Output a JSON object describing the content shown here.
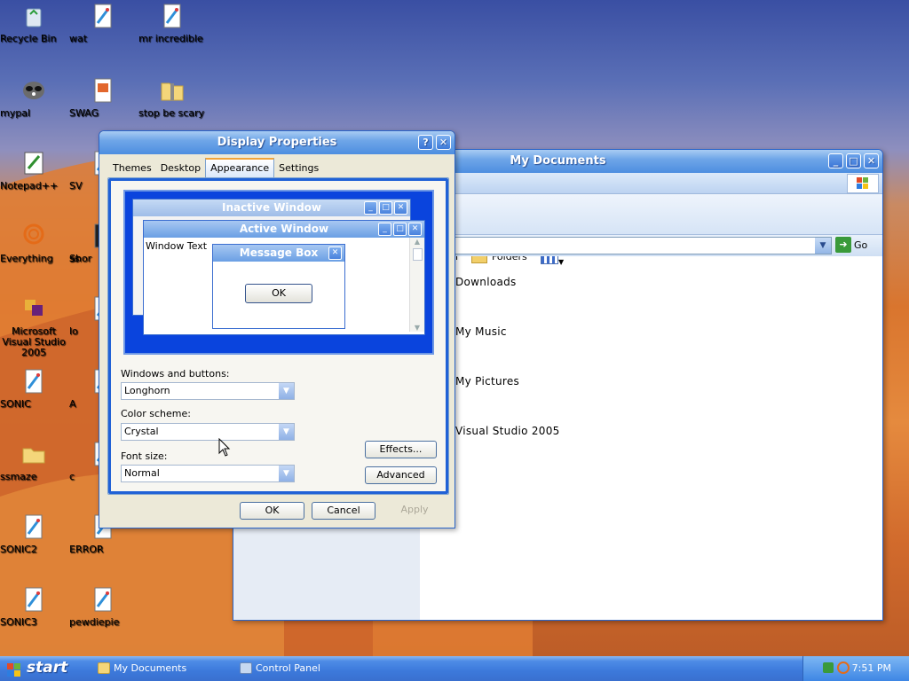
{
  "desktop": {
    "icons": [
      {
        "label": "Recycle Bin",
        "icon": "recycle-bin-icon"
      },
      {
        "label": "wat",
        "icon": "paint-file-icon"
      },
      {
        "label": "mr incredible",
        "icon": "paint-file-icon"
      },
      {
        "label": "mypal",
        "icon": "raccoon-shortcut-icon"
      },
      {
        "label": "SWAG",
        "icon": "image-file-icon"
      },
      {
        "label": "stop be scary",
        "icon": "zip-folder-icon"
      },
      {
        "label": "Notepad++",
        "icon": "notepadplusplus-icon"
      },
      {
        "label": "Everything",
        "icon": "everything-search-icon"
      },
      {
        "label": "Microsoft Visual Studio 2005",
        "icon": "visual-studio-icon"
      },
      {
        "label": "SONIC",
        "icon": "paint-file-icon"
      },
      {
        "label": "ssmaze",
        "icon": "folder-icon"
      },
      {
        "label": "SONIC2",
        "icon": "paint-file-icon"
      },
      {
        "label": "ERROR",
        "icon": "paint-file-icon"
      },
      {
        "label": "SONIC3",
        "icon": "paint-file-icon"
      },
      {
        "label": "pewdiepie",
        "icon": "paint-file-icon"
      }
    ],
    "partial_labels": [
      "SV",
      "Shor",
      "ss",
      "lo",
      "A",
      "c"
    ]
  },
  "mydocs": {
    "title": "My Documents",
    "nav_partial": "n",
    "folders_label": "Folders",
    "go_label": "Go",
    "items": [
      "Downloads",
      "My Music",
      "My Pictures",
      "Visual Studio 2005"
    ]
  },
  "display": {
    "title": "Display Properties",
    "tabs": [
      "Themes",
      "Desktop",
      "Appearance",
      "Settings"
    ],
    "active_tab": "Appearance",
    "preview": {
      "inactive_title": "Inactive Window",
      "active_title": "Active Window",
      "window_text": "Window Text",
      "message_title": "Message Box",
      "ok": "OK"
    },
    "windows_buttons_label": "Windows and buttons:",
    "windows_buttons_value": "Longhorn",
    "color_scheme_label": "Color scheme:",
    "color_scheme_value": "Crystal",
    "font_size_label": "Font size:",
    "font_size_value": "Normal",
    "effects_label": "Effects...",
    "advanced_label": "Advanced",
    "ok_label": "OK",
    "cancel_label": "Cancel",
    "apply_label": "Apply"
  },
  "taskbar": {
    "start_label": "start",
    "tasks": [
      "My Documents",
      "Control Panel"
    ],
    "clock": "7:51 PM"
  },
  "colors": {
    "taskbar_blue": "#3c79db",
    "title_blue": "#6fa6e8",
    "preview_blue": "#0a44dd"
  }
}
